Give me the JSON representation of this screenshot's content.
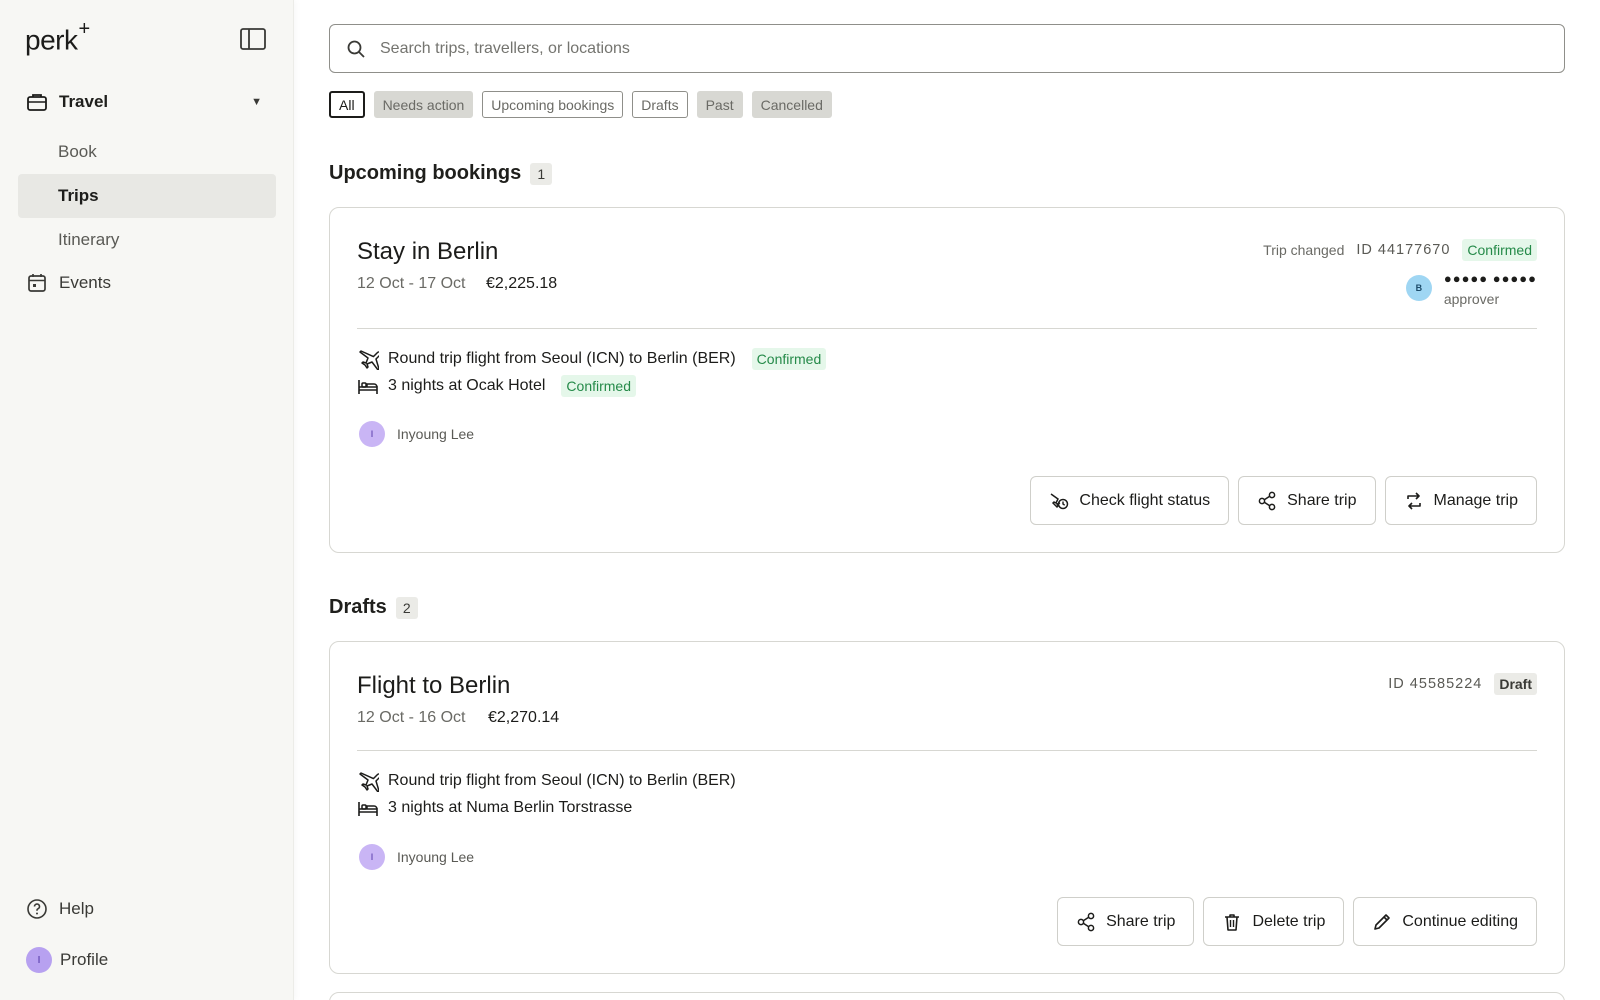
{
  "sidebar": {
    "logo": "perk",
    "logo_mark": "+",
    "travel_label": "Travel",
    "sub_items": [
      "Book",
      "Trips",
      "Itinerary"
    ],
    "events_label": "Events",
    "help_label": "Help",
    "profile_label": "Profile",
    "profile_initial": "I"
  },
  "search": {
    "placeholder": "Search trips, travellers, or locations"
  },
  "filters": [
    "All",
    "Needs action",
    "Upcoming bookings",
    "Drafts",
    "Past",
    "Cancelled"
  ],
  "upcoming": {
    "title": "Upcoming bookings",
    "count": "1",
    "trip": {
      "title": "Stay in Berlin",
      "dates": "12 Oct - 17 Oct",
      "price": "€2,225.18",
      "changed": "Trip changed",
      "id": "ID 44177670",
      "status": "Confirmed",
      "approver_initial": "B",
      "approver_name": "●●●●● ●●●●●",
      "approver_role": "approver",
      "flight": "Round trip flight from Seoul (ICN) to Berlin (BER)",
      "flight_status": "Confirmed",
      "hotel": "3 nights at Ocak Hotel",
      "hotel_status": "Confirmed",
      "traveller_initial": "I",
      "traveller": "Inyoung Lee",
      "actions": [
        "Check flight status",
        "Share trip",
        "Manage trip"
      ]
    }
  },
  "drafts": {
    "title": "Drafts",
    "count": "2",
    "trip": {
      "title": "Flight to Berlin",
      "dates": "12 Oct - 16 Oct",
      "price": "€2,270.14",
      "id": "ID 45585224",
      "status": "Draft",
      "flight": "Round trip flight from Seoul (ICN) to Berlin (BER)",
      "hotel": "3 nights at Numa Berlin Torstrasse",
      "traveller_initial": "I",
      "traveller": "Inyoung Lee",
      "actions": [
        "Share trip",
        "Delete trip",
        "Continue editing"
      ]
    }
  },
  "colors": {
    "confirmed_bg": "#e5f7ea",
    "confirmed_fg": "#258a49",
    "active_nav": "#e8e8e4"
  },
  "icons": [
    "briefcase-icon",
    "calendar-icon",
    "help-icon",
    "search-icon",
    "plane-icon",
    "bed-icon",
    "flight-status-icon",
    "share-icon",
    "manage-icon",
    "trash-icon",
    "pencil-icon",
    "sidebar-toggle-icon"
  ]
}
